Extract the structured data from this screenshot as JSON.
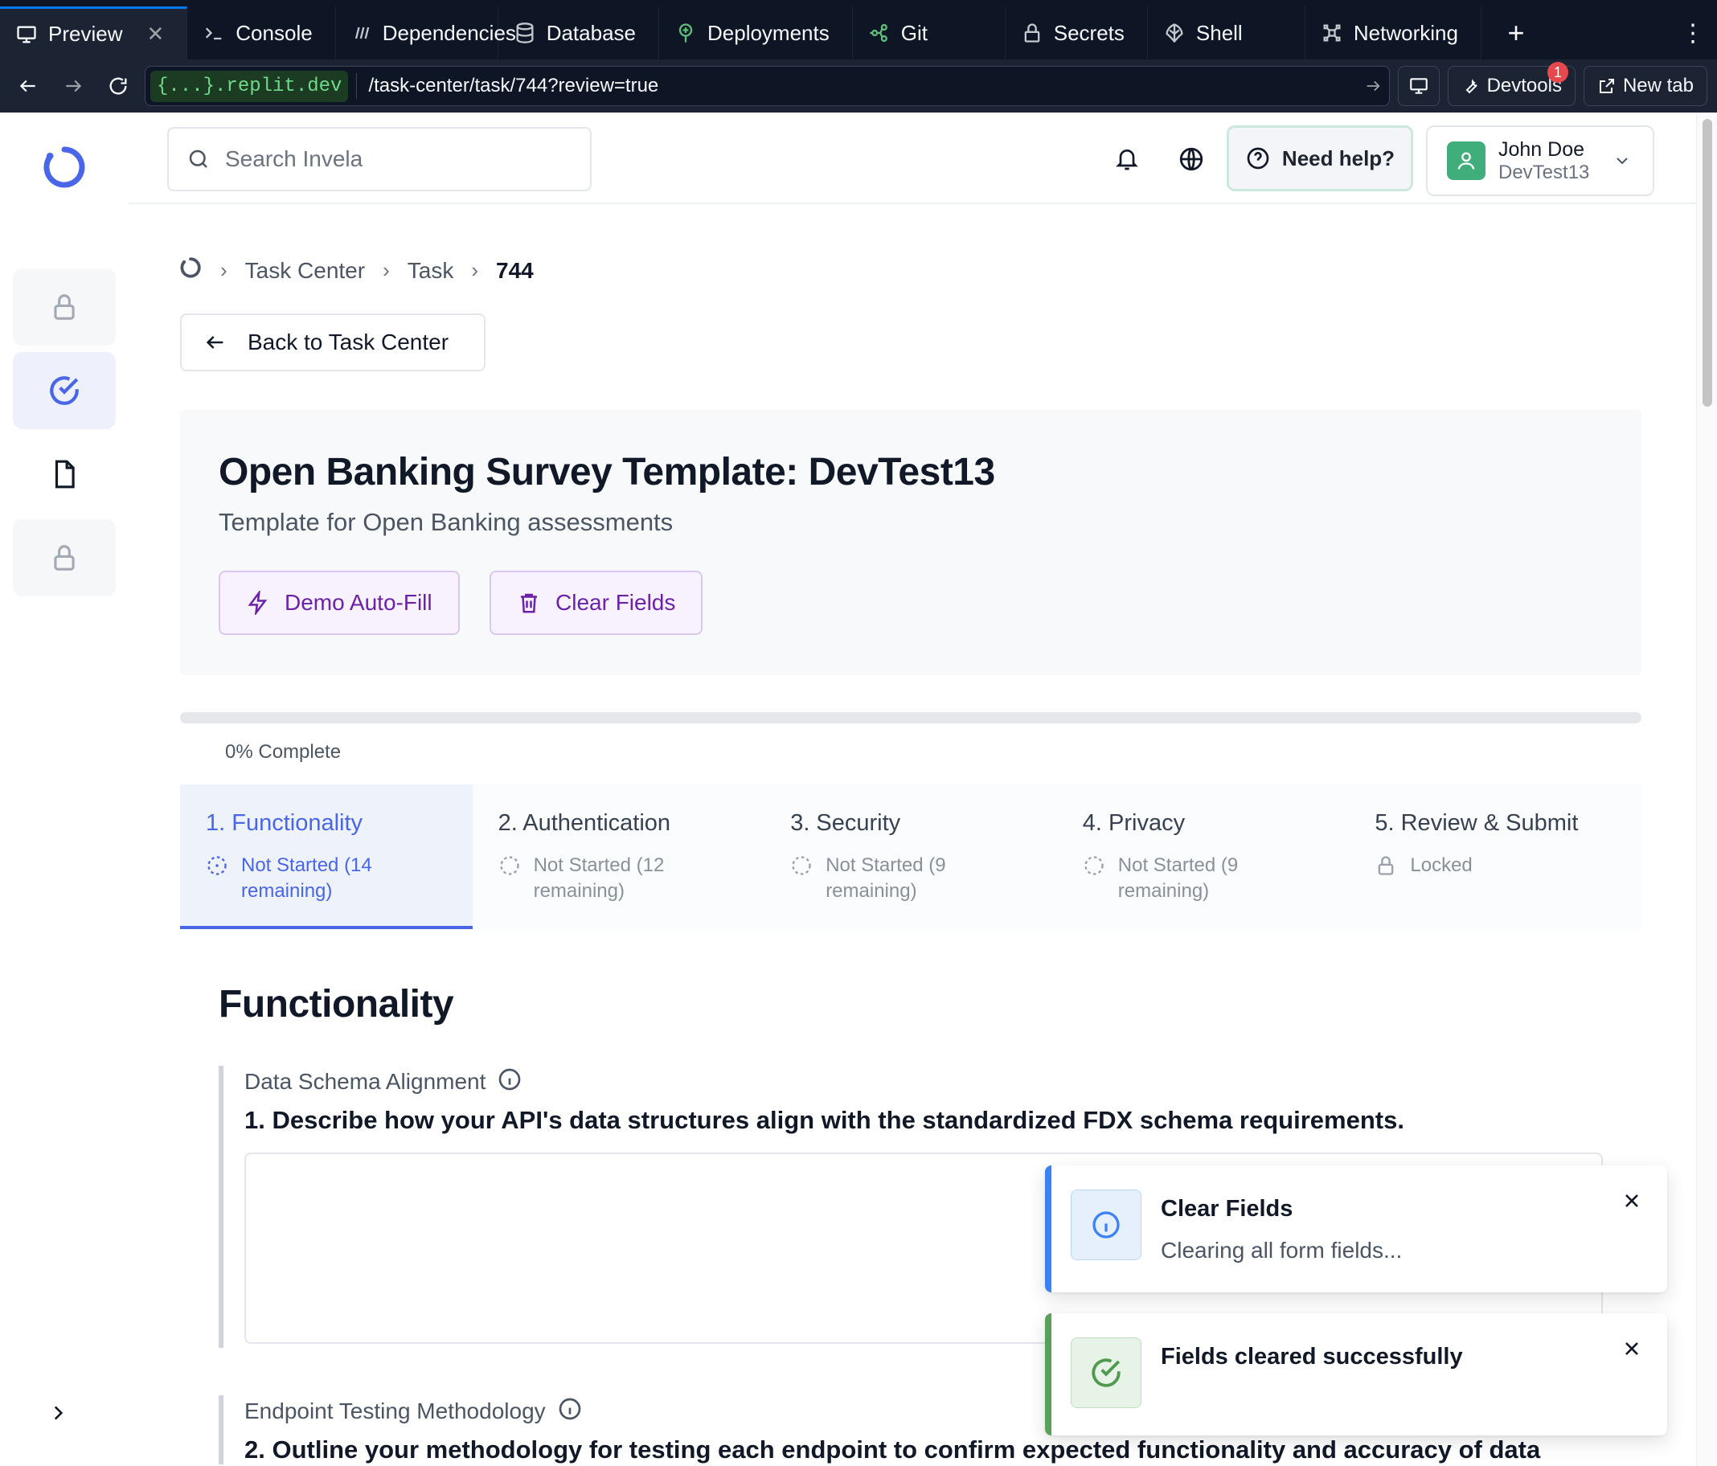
{
  "browser": {
    "tabs": [
      {
        "label": "Preview",
        "icon": "monitor-icon",
        "active": true
      },
      {
        "label": "Console",
        "icon": "terminal-icon"
      },
      {
        "label": "Dependencies",
        "icon": "dependencies-icon"
      },
      {
        "label": "Database",
        "icon": "database-icon"
      },
      {
        "label": "Deployments",
        "icon": "deployments-icon"
      },
      {
        "label": "Git",
        "icon": "git-icon"
      },
      {
        "label": "Secrets",
        "icon": "lock-icon"
      },
      {
        "label": "Shell",
        "icon": "shell-icon"
      },
      {
        "label": "Networking",
        "icon": "networking-icon"
      }
    ],
    "url_host": "{...}.replit.dev",
    "url_path": "/task-center/task/744?review=true",
    "devtools_label": "Devtools",
    "devtools_badge": "1",
    "newtab_label": "New tab"
  },
  "topbar": {
    "search_placeholder": "Search Invela",
    "help_label": "Need help?",
    "user_name": "John Doe",
    "user_company": "DevTest13"
  },
  "breadcrumb": {
    "items": [
      "Task Center",
      "Task",
      "744"
    ]
  },
  "back_button": "Back to Task Center",
  "header": {
    "title": "Open Banking Survey Template: DevTest13",
    "subtitle": "Template for Open Banking assessments",
    "autofill_label": "Demo Auto-Fill",
    "clear_label": "Clear Fields"
  },
  "progress": {
    "percent": 0,
    "label": "0% Complete"
  },
  "steps": [
    {
      "title": "1. Functionality",
      "status": "Not Started (14 remaining)",
      "active": true
    },
    {
      "title": "2. Authentication",
      "status": "Not Started (12 remaining)"
    },
    {
      "title": "3. Security",
      "status": "Not Started (9 remaining)"
    },
    {
      "title": "4. Privacy",
      "status": "Not Started (9 remaining)"
    },
    {
      "title": "5. Review & Submit",
      "status": "Locked",
      "locked": true
    }
  ],
  "section": {
    "title": "Functionality",
    "questions": [
      {
        "category": "Data Schema Alignment",
        "text": "1. Describe how your API's data structures align with the standardized FDX schema requirements.",
        "answer": ""
      },
      {
        "category": "Endpoint Testing Methodology",
        "text": "2. Outline your methodology for testing each endpoint to confirm expected functionality and accuracy of data"
      }
    ]
  },
  "toasts": [
    {
      "title": "Clear Fields",
      "description": "Clearing all form fields...",
      "kind": "info"
    },
    {
      "title": "Fields cleared successfully",
      "description": "",
      "kind": "success"
    }
  ],
  "colors": {
    "accent": "#4965e8",
    "purple_action": "#6b21a8",
    "info": "#3b82f6",
    "success": "#5aa05a",
    "replit_bg": "#0e1525"
  }
}
